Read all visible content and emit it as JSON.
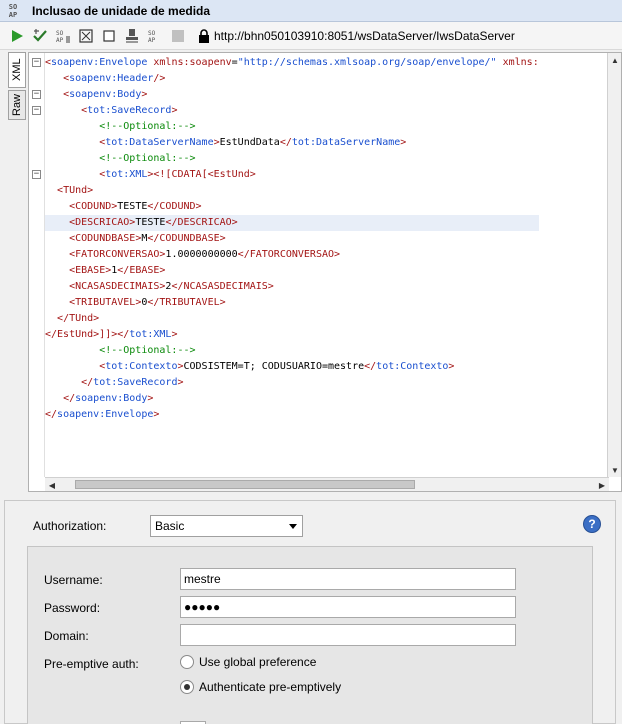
{
  "window": {
    "badge_top": "SO",
    "badge_bottom": "AP",
    "title": "Inclusao de unidade de medida"
  },
  "toolbar": {
    "buttons": [
      "play-icon",
      "validate-icon",
      "soap-icon",
      "fullscreen-icon",
      "stop-icon",
      "stamp-icon",
      "soap-icon-2",
      "disabled-icon",
      "lock-icon"
    ],
    "url": "http://bhn050103910:8051/wsDataServer/IwsDataServer"
  },
  "side_tabs": {
    "xml": "XML",
    "raw": "Raw"
  },
  "editor": {
    "lines": [
      {
        "indent": "",
        "parts": [
          [
            "t",
            "<"
          ],
          [
            "tn",
            "soapenv:Envelope"
          ],
          [
            "atn",
            " xmlns:soapenv"
          ],
          [
            "tx",
            "="
          ],
          [
            "atv",
            "\"http://schemas.xmlsoap.org/soap/envelope/\""
          ],
          [
            "atn",
            " xmlns:"
          ]
        ]
      },
      {
        "indent": "   ",
        "parts": [
          [
            "t",
            "<"
          ],
          [
            "tn",
            "soapenv:Header"
          ],
          [
            "t",
            "/>"
          ]
        ]
      },
      {
        "indent": "   ",
        "parts": [
          [
            "t",
            "<"
          ],
          [
            "tn",
            "soapenv:Body"
          ],
          [
            "t",
            ">"
          ]
        ]
      },
      {
        "indent": "      ",
        "parts": [
          [
            "t",
            "<"
          ],
          [
            "tn",
            "tot:SaveRecord"
          ],
          [
            "t",
            ">"
          ]
        ]
      },
      {
        "indent": "         ",
        "parts": [
          [
            "cm",
            "<!--Optional:-->"
          ]
        ]
      },
      {
        "indent": "         ",
        "parts": [
          [
            "t",
            "<"
          ],
          [
            "tn",
            "tot:DataServerName"
          ],
          [
            "t",
            ">"
          ],
          [
            "tx",
            "EstUndData"
          ],
          [
            "t",
            "</"
          ],
          [
            "tn",
            "tot:DataServerName"
          ],
          [
            "t",
            ">"
          ]
        ]
      },
      {
        "indent": "         ",
        "parts": [
          [
            "cm",
            "<!--Optional:-->"
          ]
        ]
      },
      {
        "indent": "         ",
        "parts": [
          [
            "t",
            "<"
          ],
          [
            "tn",
            "tot:XML"
          ],
          [
            "t",
            ">"
          ],
          [
            "t",
            "<![CDATA[<EstUnd>"
          ]
        ]
      },
      {
        "indent": "  ",
        "parts": [
          [
            "t",
            "<TUnd>"
          ]
        ]
      },
      {
        "indent": "    ",
        "parts": [
          [
            "t",
            "<CODUND>"
          ],
          [
            "tx",
            "TESTE"
          ],
          [
            "t",
            "</CODUND>"
          ]
        ]
      },
      {
        "indent": "    ",
        "parts": [
          [
            "t",
            "<DESCRICAO>"
          ],
          [
            "tx",
            "TESTE"
          ],
          [
            "t",
            "</DESCRICAO>"
          ]
        ],
        "hl": true
      },
      {
        "indent": "    ",
        "parts": [
          [
            "t",
            "<CODUNDBASE>"
          ],
          [
            "tx",
            "M"
          ],
          [
            "t",
            "</CODUNDBASE>"
          ]
        ]
      },
      {
        "indent": "    ",
        "parts": [
          [
            "t",
            "<FATORCONVERSAO>"
          ],
          [
            "tx",
            "1.0000000000"
          ],
          [
            "t",
            "</FATORCONVERSAO>"
          ]
        ]
      },
      {
        "indent": "    ",
        "parts": [
          [
            "t",
            "<EBASE>"
          ],
          [
            "tx",
            "1"
          ],
          [
            "t",
            "</EBASE>"
          ]
        ]
      },
      {
        "indent": "    ",
        "parts": [
          [
            "t",
            "<NCASASDECIMAIS>"
          ],
          [
            "tx",
            "2"
          ],
          [
            "t",
            "</NCASASDECIMAIS>"
          ]
        ]
      },
      {
        "indent": "    ",
        "parts": [
          [
            "t",
            "<TRIBUTAVEL>"
          ],
          [
            "tx",
            "0"
          ],
          [
            "t",
            "</TRIBUTAVEL>"
          ]
        ]
      },
      {
        "indent": "  ",
        "parts": [
          [
            "t",
            "</TUnd>"
          ]
        ]
      },
      {
        "indent": "",
        "parts": [
          [
            "t",
            "</EstUnd>]]>"
          ],
          [
            "t",
            "</"
          ],
          [
            "tn",
            "tot:XML"
          ],
          [
            "t",
            ">"
          ]
        ]
      },
      {
        "indent": "         ",
        "parts": [
          [
            "cm",
            "<!--Optional:-->"
          ]
        ]
      },
      {
        "indent": "         ",
        "parts": [
          [
            "t",
            "<"
          ],
          [
            "tn",
            "tot:Contexto"
          ],
          [
            "t",
            ">"
          ],
          [
            "tx",
            "CODSISTEM=T; CODUSUARIO=mestre"
          ],
          [
            "t",
            "</"
          ],
          [
            "tn",
            "tot:Contexto"
          ],
          [
            "t",
            ">"
          ]
        ]
      },
      {
        "indent": "      ",
        "parts": [
          [
            "t",
            "</"
          ],
          [
            "tn",
            "tot:SaveRecord"
          ],
          [
            "t",
            ">"
          ]
        ]
      },
      {
        "indent": "   ",
        "parts": [
          [
            "t",
            "</"
          ],
          [
            "tn",
            "soapenv:Body"
          ],
          [
            "t",
            ">"
          ]
        ]
      },
      {
        "indent": "",
        "parts": [
          [
            "t",
            "</"
          ],
          [
            "tn",
            "soapenv:Envelope"
          ],
          [
            "t",
            ">"
          ]
        ]
      }
    ]
  },
  "auth": {
    "label": "Authorization:",
    "selected": "Basic",
    "help_glyph": "?",
    "username_label": "Username:",
    "username_value": "mestre",
    "password_label": "Password:",
    "password_value": "●●●●●",
    "domain_label": "Domain:",
    "domain_value": "",
    "preemptive_label": "Pre-emptive auth:",
    "option_global": "Use global preference",
    "option_preemptive": "Authenticate pre-emptively",
    "selected_option": "Authenticate pre-emptively"
  }
}
